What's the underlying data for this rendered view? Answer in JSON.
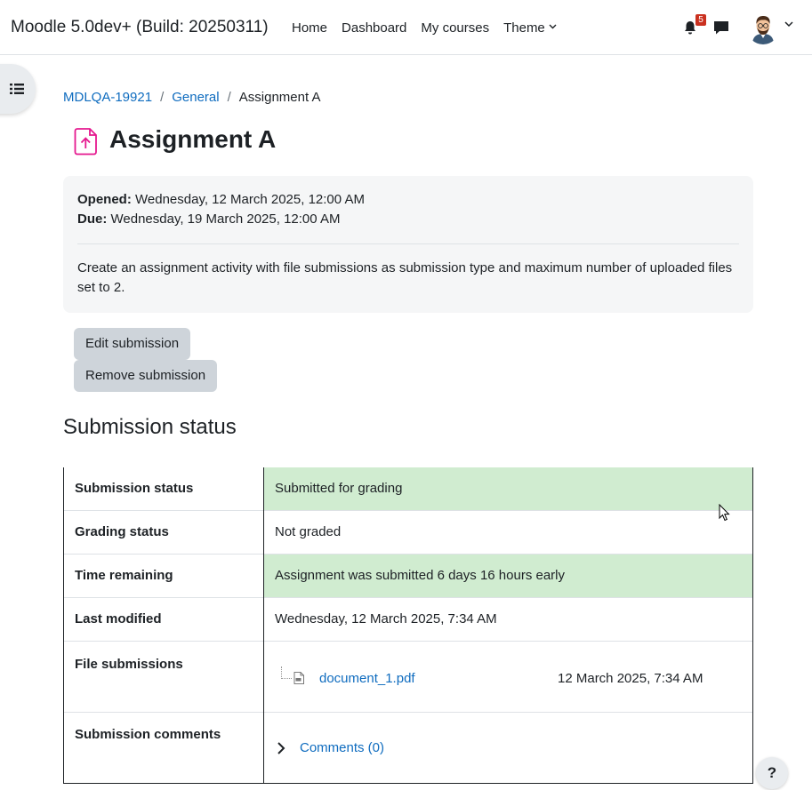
{
  "navbar": {
    "site_name": "Moodle 5.0dev+ (Build: 20250311)",
    "items": [
      {
        "label": "Home"
      },
      {
        "label": "Dashboard"
      },
      {
        "label": "My courses"
      },
      {
        "label": "Theme"
      }
    ],
    "notification_count": "5"
  },
  "breadcrumb": {
    "items": [
      "MDLQA-19921",
      "General",
      "Assignment A"
    ]
  },
  "page": {
    "title": "Assignment A",
    "opened_label": "Opened:",
    "opened_value": " Wednesday, 12 March 2025, 12:00 AM",
    "due_label": "Due:",
    "due_value": " Wednesday, 19 March 2025, 12:00 AM",
    "intro": "Create an assignment activity with file submissions as submission type and maximum number of uploaded files set to 2."
  },
  "actions": {
    "edit_label": "Edit submission",
    "remove_label": "Remove submission"
  },
  "status": {
    "heading": "Submission status",
    "rows": [
      {
        "label": "Submission status",
        "value": "Submitted for grading"
      },
      {
        "label": "Grading status",
        "value": "Not graded"
      },
      {
        "label": "Time remaining",
        "value": "Assignment was submitted 6 days 16 hours early"
      },
      {
        "label": "Last modified",
        "value": "Wednesday, 12 March 2025, 7:34 AM"
      },
      {
        "label": "File submissions",
        "file_name": "document_1.pdf",
        "file_date": "12 March 2025, 7:34 AM"
      },
      {
        "label": "Submission comments",
        "comments_link": "Comments (0)"
      }
    ]
  },
  "help": {
    "label": "?"
  },
  "colors": {
    "accent": "#0f6cbf",
    "success_bg": "#d0ecd0",
    "assignment_icon": "#e5198f",
    "badge": "#ca3120"
  }
}
